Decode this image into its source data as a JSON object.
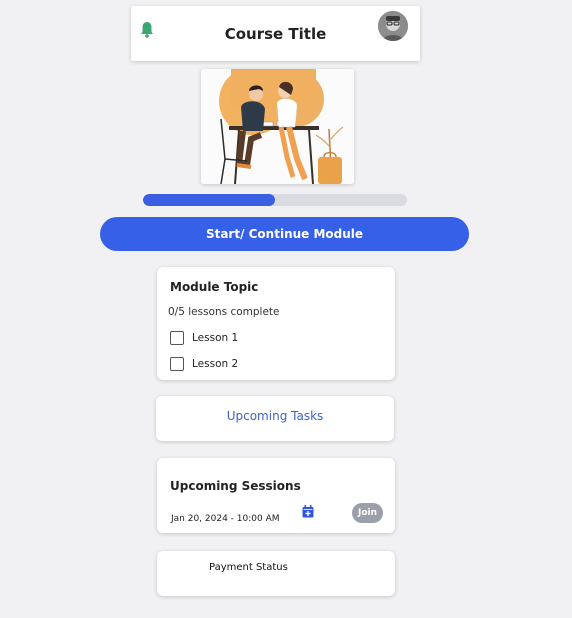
{
  "header": {
    "title": "Course Title",
    "bell_color": "#3aa872"
  },
  "progress": {
    "fraction": 0.5,
    "fill_color": "#3a5fe0"
  },
  "start_button": {
    "label": "Start/ Continue Module",
    "color": "#3660e8"
  },
  "module": {
    "title": "Module Topic",
    "progress_text": "0/5 lessons complete",
    "lessons": [
      {
        "label": "Lesson 1",
        "checked": false
      },
      {
        "label": "Lesson 2",
        "checked": false
      }
    ]
  },
  "tasks": {
    "label": "Upcoming Tasks",
    "color": "#3e62c8"
  },
  "sessions": {
    "title": "Upcoming Sessions",
    "date": "Jan 20, 2024 - 10:00 AM",
    "join_label": "Join",
    "calendar_icon": "calendar-add-icon"
  },
  "payment": {
    "label": "Payment Status"
  }
}
